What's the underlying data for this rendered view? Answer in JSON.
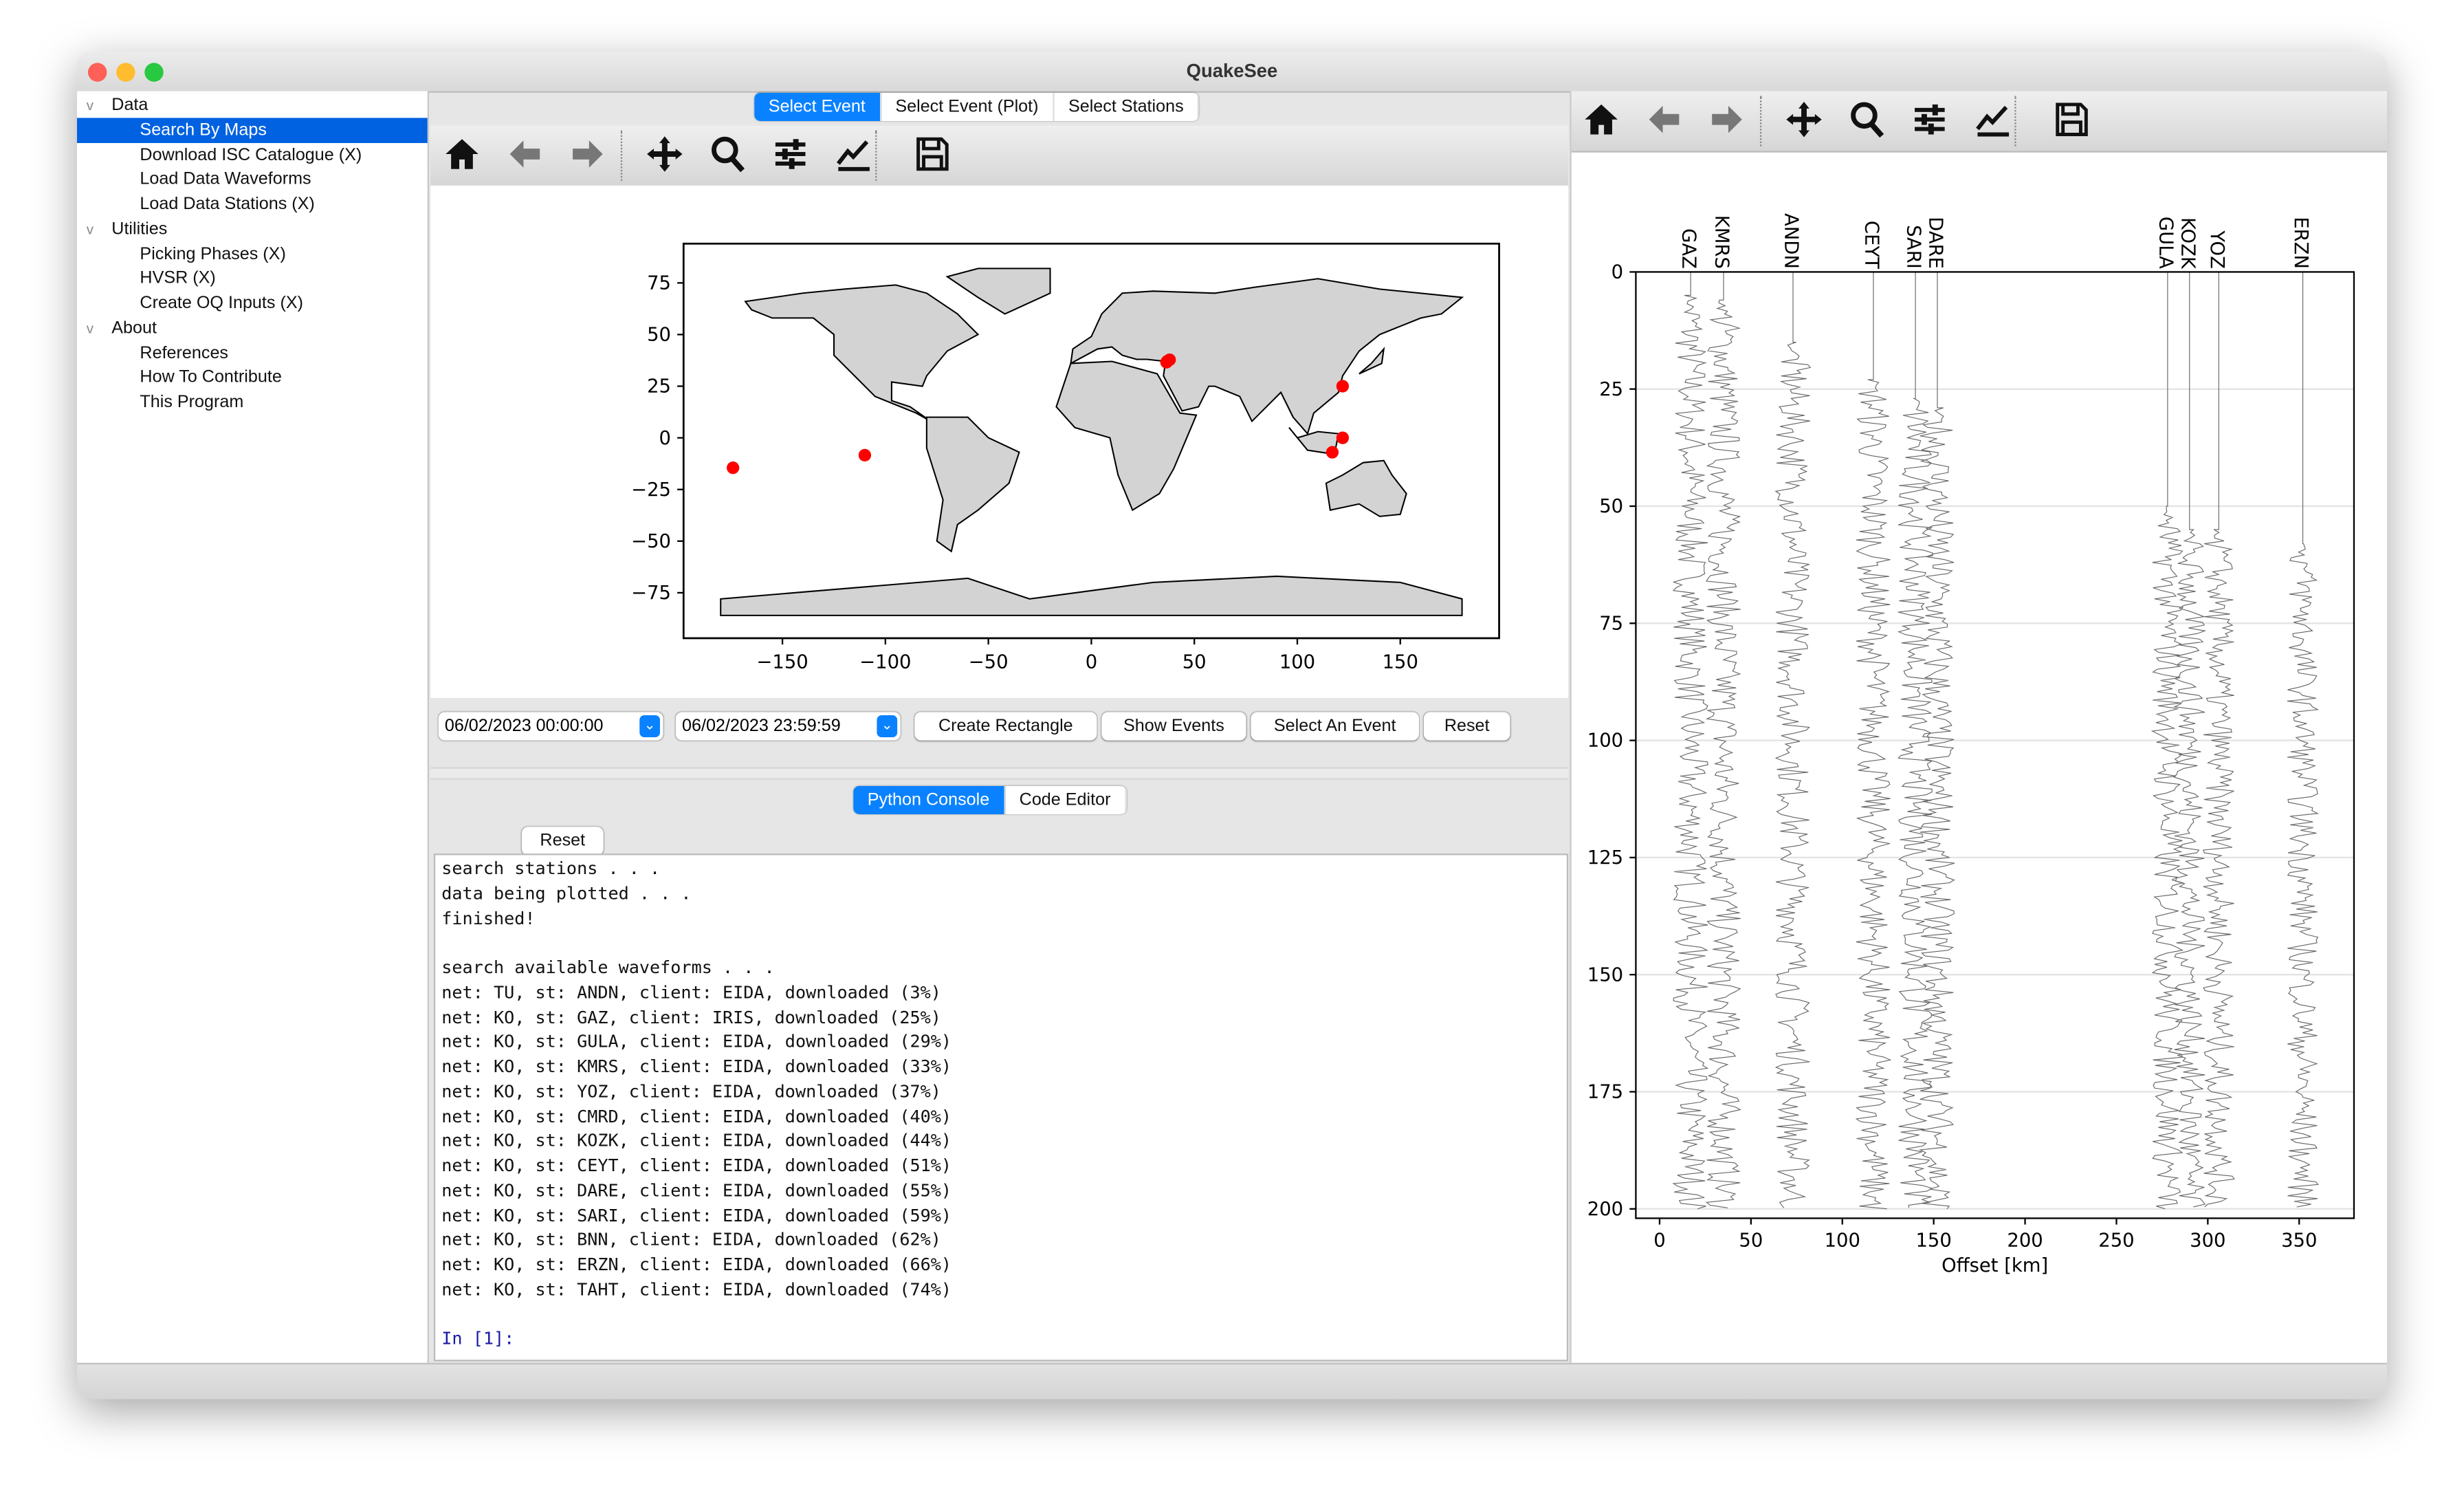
{
  "window": {
    "title": "QuakeSee"
  },
  "sidebar": {
    "items": [
      {
        "label": "Data",
        "level": 0,
        "expanded": true
      },
      {
        "label": "Search By Maps",
        "level": 1,
        "selected": true
      },
      {
        "label": "Download ISC Catalogue (X)",
        "level": 1
      },
      {
        "label": "Load Data Waveforms",
        "level": 1
      },
      {
        "label": "Load Data Stations (X)",
        "level": 1
      },
      {
        "label": "Utilities",
        "level": 0,
        "expanded": true
      },
      {
        "label": "Picking Phases (X)",
        "level": 1
      },
      {
        "label": "HVSR (X)",
        "level": 1
      },
      {
        "label": "Create OQ Inputs (X)",
        "level": 1
      },
      {
        "label": "About",
        "level": 0,
        "expanded": true
      },
      {
        "label": "References",
        "level": 1
      },
      {
        "label": "How To Contribute",
        "level": 1
      },
      {
        "label": "This Program",
        "level": 1
      }
    ]
  },
  "main_tabs": [
    {
      "label": "Select Event",
      "active": true
    },
    {
      "label": "Select Event (Plot)"
    },
    {
      "label": "Select Stations"
    }
  ],
  "toolbar_icons": [
    "home-icon",
    "back-arrow-icon",
    "forward-arrow-icon",
    "pan-icon",
    "zoom-icon",
    "subplots-icon",
    "edit-axes-icon",
    "save-icon"
  ],
  "controls": {
    "start_datetime": "06/02/2023 00:00:00",
    "end_datetime": "06/02/2023 23:59:59",
    "create_rectangle": "Create Rectangle",
    "show_events": "Show Events",
    "select_event": "Select An Event",
    "reset": "Reset"
  },
  "console_tabs": [
    {
      "label": "Python Console",
      "active": true
    },
    {
      "label": "Code Editor"
    }
  ],
  "console": {
    "reset": "Reset",
    "lines": [
      "search stations . . .",
      "data being plotted . . .",
      "finished!",
      "",
      "search available waveforms . . .",
      "net: TU, st: ANDN, client: EIDA, downloaded (3%)",
      "net: KO, st: GAZ, client: IRIS, downloaded (25%)",
      "net: KO, st: GULA, client: EIDA, downloaded (29%)",
      "net: KO, st: KMRS, client: EIDA, downloaded (33%)",
      "net: KO, st: YOZ, client: EIDA, downloaded (37%)",
      "net: KO, st: CMRD, client: EIDA, downloaded (40%)",
      "net: KO, st: KOZK, client: EIDA, downloaded (44%)",
      "net: KO, st: CEYT, client: EIDA, downloaded (51%)",
      "net: KO, st: DARE, client: EIDA, downloaded (55%)",
      "net: KO, st: SARI, client: EIDA, downloaded (59%)",
      "net: KO, st: BNN, client: EIDA, downloaded (62%)",
      "net: KO, st: ERZN, client: EIDA, downloaded (66%)",
      "net: KO, st: TAHT, client: EIDA, downloaded (74%)"
    ],
    "prompt": "In [1]:",
    "prompt_color": "#1a1aa6"
  },
  "colors": {
    "accent": "#0a82ff",
    "selection": "#0062e1",
    "event": "#ff0000",
    "land": "#d3d3d3"
  },
  "chart_data": [
    {
      "type": "scatter",
      "xticks": [
        -150,
        -100,
        -50,
        0,
        50,
        100,
        150
      ],
      "yticks": [
        75,
        50,
        25,
        0,
        -25,
        -50,
        -75
      ],
      "xlim": [
        -198,
        198
      ],
      "ylim": [
        -97,
        94
      ],
      "background": "world-map",
      "points": [
        {
          "lon": 37,
          "lat": 37.2
        },
        {
          "lon": 38,
          "lat": 37.8
        },
        {
          "lon": 36.5,
          "lat": 36.6
        },
        {
          "lon": 122,
          "lat": 25
        },
        {
          "lon": 122,
          "lat": 0
        },
        {
          "lon": 117,
          "lat": -7
        },
        {
          "lon": -110,
          "lat": -8.4
        },
        {
          "lon": -174,
          "lat": -14.5
        }
      ]
    },
    {
      "type": "line",
      "xlabel": "Offset [km]",
      "xticks": [
        0,
        50,
        100,
        150,
        200,
        250,
        300,
        350
      ],
      "yticks": [
        0,
        25,
        50,
        75,
        100,
        125,
        150,
        175,
        200
      ],
      "xlim": [
        -13,
        380
      ],
      "ylim": [
        0,
        202
      ],
      "y_inverted": true,
      "grid": true,
      "series": [
        {
          "name": "GAZ",
          "offset": 17,
          "onset": 5
        },
        {
          "name": "KMRS",
          "offset": 35,
          "onset": 6
        },
        {
          "name": "ANDN",
          "offset": 73,
          "onset": 15
        },
        {
          "name": "CEYT",
          "offset": 117,
          "onset": 23
        },
        {
          "name": "SARI",
          "offset": 140,
          "onset": 27
        },
        {
          "name": "DARE",
          "offset": 152,
          "onset": 29
        },
        {
          "name": "GULA",
          "offset": 278,
          "onset": 50
        },
        {
          "name": "KOZK",
          "offset": 290,
          "onset": 55
        },
        {
          "name": "YOZ",
          "offset": 306,
          "onset": 55
        },
        {
          "name": "ERZN",
          "offset": 352,
          "onset": 58
        }
      ]
    }
  ]
}
